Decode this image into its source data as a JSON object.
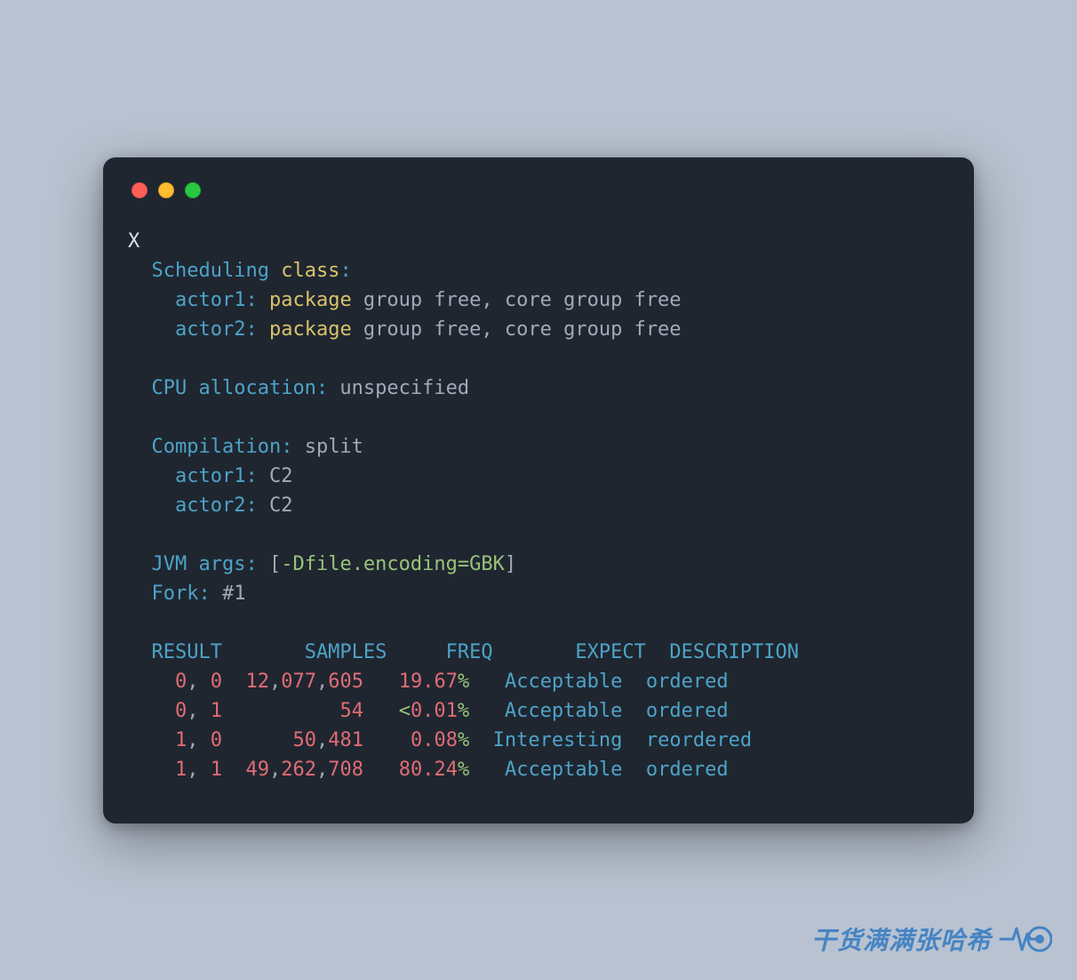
{
  "prompt": "X",
  "scheduling": {
    "title": "Scheduling",
    "class_kw": "class",
    "colon": ":",
    "actors": [
      {
        "name": "actor1",
        "package_kw": "package",
        "rest": " group free, core group free"
      },
      {
        "name": "actor2",
        "package_kw": "package",
        "rest": " group free, core group free"
      }
    ]
  },
  "cpu_alloc": {
    "label": "CPU allocation:",
    "value": " unspecified"
  },
  "compilation": {
    "label": "Compilation:",
    "value": " split",
    "actors": [
      {
        "name": "actor1",
        "compiler": " C2"
      },
      {
        "name": "actor2",
        "compiler": " C2"
      }
    ]
  },
  "jvm_args": {
    "label": "JVM args:",
    "open": " [",
    "flag": "-Dfile.encoding=GBK",
    "close": "]"
  },
  "fork": {
    "label": "Fork:",
    "value": " #1"
  },
  "table": {
    "headers": {
      "result": "RESULT",
      "samples": "SAMPLES",
      "freq": "FREQ",
      "expect": "EXPECT",
      "description": "DESCRIPTION"
    },
    "rows": [
      {
        "r_a": "0",
        "r_b": "0",
        "samples": "12,077,605",
        "freq_lt": "",
        "freq_num": "19.67",
        "freq_pct": "%",
        "expect": "Acceptable",
        "description": "ordered"
      },
      {
        "r_a": "0",
        "r_b": "1",
        "samples": "54",
        "freq_lt": "<",
        "freq_num": "0.01",
        "freq_pct": "%",
        "expect": "Acceptable",
        "description": "ordered"
      },
      {
        "r_a": "1",
        "r_b": "0",
        "samples": "50,481",
        "freq_lt": "",
        "freq_num": "0.08",
        "freq_pct": "%",
        "expect": "Interesting",
        "description": "reordered"
      },
      {
        "r_a": "1",
        "r_b": "1",
        "samples": "49,262,708",
        "freq_lt": "",
        "freq_num": "80.24",
        "freq_pct": "%",
        "expect": "Acceptable",
        "description": "ordered"
      }
    ]
  },
  "watermark_text": "干货满满张哈希"
}
